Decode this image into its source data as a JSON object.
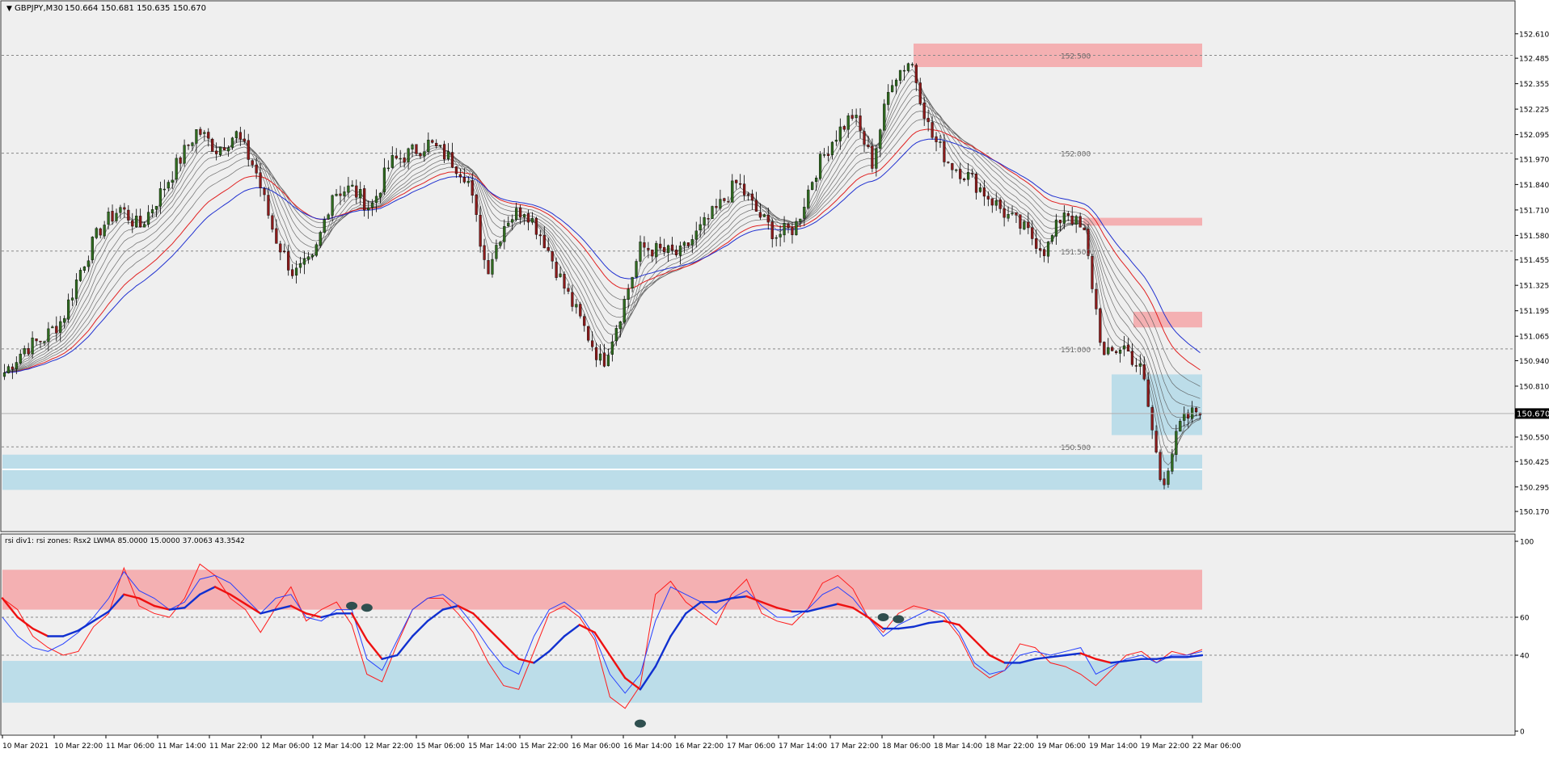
{
  "header": {
    "symbol_label": "GBPJPY,M30",
    "ohlc_label": "150.664 150.681 150.635 150.670"
  },
  "indicator": {
    "label": "rsi div1: rsi zones: Rsx2 LWMA 85.0000 15.0000 37.0063 43.3542"
  },
  "colors": {
    "background": "#efefef",
    "bull_candle": "#2f6b1f",
    "bear_candle": "#8b1a1a",
    "ma_main": "#555555",
    "ma_red": "#e02020",
    "ma_blue": "#2030d0",
    "supply_zone": "#f4b0b2",
    "demand_zone": "#bcdde9",
    "rsi_fast": "#ff1a1a",
    "rsi_thin": "#2540ff",
    "rsi_slow_bear": "#ee1111",
    "rsi_slow_bull": "#1030d0",
    "divergence_marker": "#2f4f4f"
  },
  "chart_data": [
    {
      "type": "candlestick",
      "title": "GBPJPY,M30",
      "current_price": "150.670",
      "ylim": [
        150.1,
        152.7
      ],
      "y_ticks": [
        "152.610",
        "152.485",
        "152.355",
        "152.225",
        "152.095",
        "151.970",
        "151.840",
        "151.710",
        "151.580",
        "151.455",
        "151.325",
        "151.195",
        "151.065",
        "150.940",
        "150.810",
        "150.680",
        "150.550",
        "150.425",
        "150.295",
        "150.170"
      ],
      "x_labels": [
        "10 Mar 2021",
        "10 Mar 22:00",
        "11 Mar 06:00",
        "11 Mar 14:00",
        "11 Mar 22:00",
        "12 Mar 06:00",
        "12 Mar 14:00",
        "12 Mar 22:00",
        "15 Mar 06:00",
        "15 Mar 14:00",
        "15 Mar 22:00",
        "16 Mar 06:00",
        "16 Mar 14:00",
        "16 Mar 22:00",
        "17 Mar 06:00",
        "17 Mar 14:00",
        "17 Mar 22:00",
        "18 Mar 06:00",
        "18 Mar 14:00",
        "18 Mar 22:00",
        "19 Mar 06:00",
        "19 Mar 14:00",
        "19 Mar 22:00",
        "22 Mar 06:00"
      ],
      "level_labels": [
        {
          "price": 152.5,
          "text": "152.500"
        },
        {
          "price": 152.0,
          "text": "152.000"
        },
        {
          "price": 151.5,
          "text": "151.500"
        },
        {
          "price": 151.0,
          "text": "151.000"
        },
        {
          "price": 150.5,
          "text": "150.500"
        }
      ],
      "anchor_prices": [
        150.88,
        151.0,
        151.05,
        151.15,
        151.42,
        151.62,
        151.72,
        151.62,
        151.78,
        151.95,
        152.12,
        152.02,
        152.1,
        151.92,
        151.58,
        151.38,
        151.45,
        151.8,
        151.82,
        151.72,
        151.95,
        152.0,
        152.05,
        151.98,
        151.88,
        151.4,
        151.66,
        151.72,
        151.55,
        151.32,
        151.12,
        150.92,
        151.2,
        151.52,
        151.5,
        151.48,
        151.6,
        151.72,
        151.85,
        151.7,
        151.58,
        151.62,
        151.9,
        152.08,
        152.2,
        151.95,
        152.38,
        152.48,
        152.1,
        151.95,
        151.88,
        151.78,
        151.68,
        151.6,
        151.5,
        151.72,
        151.58,
        150.95,
        151.02,
        150.88,
        150.3,
        150.62,
        150.7
      ]
    },
    {
      "type": "line",
      "title": "rsi div1: rsi zones: Rsx2 LWMA 85.0000 15.0000 37.0063 43.3542",
      "ylim": [
        0,
        100
      ],
      "y_ticks": [
        "100",
        "60",
        "40",
        "0"
      ],
      "levels": [
        85,
        64,
        37,
        15
      ],
      "fast_rsi": [
        70,
        64,
        50,
        44,
        40,
        42,
        55,
        62,
        86,
        66,
        62,
        60,
        70,
        88,
        82,
        70,
        64,
        52,
        65,
        76,
        58,
        64,
        68,
        56,
        30,
        26,
        46,
        64,
        70,
        70,
        62,
        52,
        36,
        24,
        22,
        42,
        62,
        66,
        60,
        48,
        18,
        12,
        24,
        72,
        79,
        68,
        62,
        56,
        72,
        80,
        62,
        58,
        56,
        64,
        78,
        82,
        75,
        60,
        52,
        62,
        66,
        64,
        60,
        50,
        34,
        28,
        32,
        46,
        44,
        36,
        34,
        30,
        24,
        32,
        40,
        42,
        36,
        42,
        40,
        43
      ],
      "rsi": [
        60,
        50,
        44,
        42,
        46,
        52,
        60,
        70,
        84,
        74,
        70,
        64,
        68,
        80,
        82,
        78,
        70,
        62,
        70,
        72,
        60,
        58,
        64,
        64,
        38,
        32,
        48,
        64,
        70,
        72,
        66,
        56,
        44,
        34,
        30,
        50,
        64,
        68,
        62,
        50,
        30,
        20,
        30,
        58,
        76,
        72,
        68,
        62,
        70,
        74,
        66,
        60,
        60,
        64,
        72,
        76,
        70,
        60,
        50,
        56,
        60,
        64,
        62,
        52,
        36,
        30,
        32,
        40,
        42,
        40,
        42,
        44,
        30,
        34,
        38,
        40,
        36,
        40,
        40,
        42
      ],
      "rsi_smooth": [
        70,
        60,
        54,
        50,
        50,
        53,
        58,
        63,
        72,
        70,
        66,
        64,
        65,
        72,
        76,
        72,
        67,
        62,
        64,
        66,
        62,
        60,
        62,
        62,
        48,
        38,
        40,
        50,
        58,
        64,
        66,
        62,
        54,
        46,
        38,
        36,
        42,
        50,
        56,
        52,
        40,
        28,
        22,
        34,
        50,
        62,
        68,
        68,
        70,
        71,
        68,
        65,
        63,
        63,
        65,
        67,
        65,
        60,
        54,
        54,
        55,
        57,
        58,
        56,
        48,
        40,
        36,
        36,
        38,
        39,
        40,
        41,
        38,
        36,
        37,
        38,
        38,
        39,
        39,
        40
      ],
      "divergence_markers": [
        {
          "index": 23,
          "value": 66
        },
        {
          "index": 24,
          "value": 65
        },
        {
          "index": 42,
          "value": 4
        },
        {
          "index": 58,
          "value": 60
        },
        {
          "index": 59,
          "value": 59
        }
      ]
    }
  ]
}
